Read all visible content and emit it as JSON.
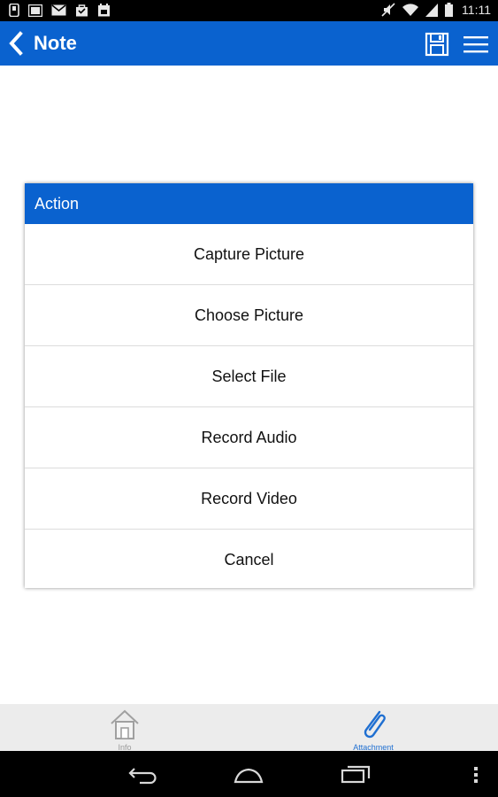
{
  "status_bar": {
    "time": "11:11",
    "icons_left": [
      "phone-icon",
      "image-icon",
      "mail-icon",
      "bag-icon",
      "calendar-icon"
    ],
    "icons_right": [
      "mute-icon",
      "wifi-icon",
      "signal-icon",
      "battery-icon"
    ]
  },
  "app_bar": {
    "title": "Note",
    "color": "#0a62cf"
  },
  "dialog": {
    "title": "Action",
    "items": [
      {
        "label": "Capture Picture"
      },
      {
        "label": "Choose Picture"
      },
      {
        "label": "Select File"
      },
      {
        "label": "Record Audio"
      },
      {
        "label": "Record Video"
      },
      {
        "label": "Cancel"
      }
    ]
  },
  "bottom_nav": {
    "tabs": [
      {
        "label": "Info",
        "icon": "house-icon",
        "active": false
      },
      {
        "label": "Attachment",
        "icon": "paperclip-icon",
        "active": true
      }
    ],
    "active_color": "#1f6fd1",
    "inactive_color": "#9a9a9a"
  }
}
